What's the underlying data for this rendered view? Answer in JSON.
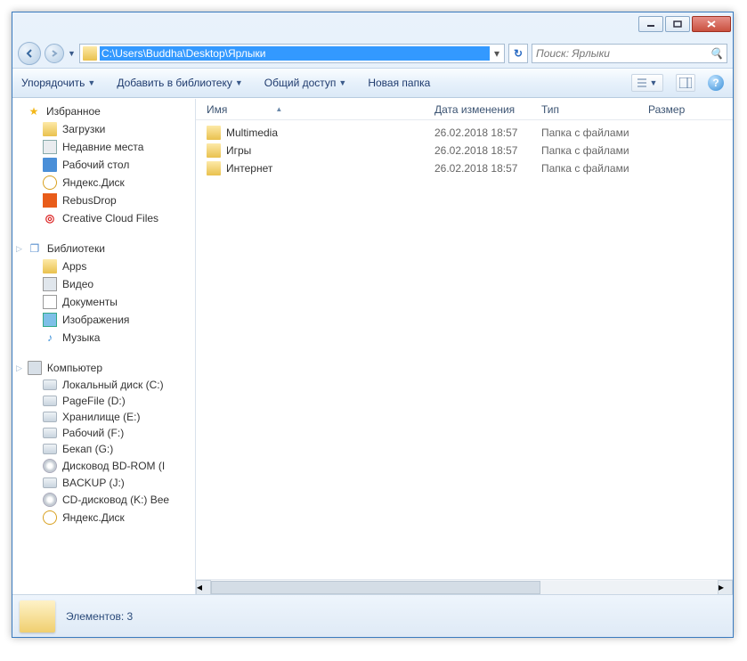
{
  "address": {
    "path": "C:\\Users\\Buddha\\Desktop\\Ярлыки"
  },
  "search": {
    "placeholder": "Поиск: Ярлыки"
  },
  "toolbar": {
    "organize": "Упорядочить",
    "addlib": "Добавить в библиотеку",
    "share": "Общий доступ",
    "newfolder": "Новая папка"
  },
  "tree": {
    "fav_header": "Избранное",
    "fav": [
      {
        "label": "Загрузки",
        "icon": "folder"
      },
      {
        "label": "Недавние места",
        "icon": "recent"
      },
      {
        "label": "Рабочий стол",
        "icon": "desktop"
      },
      {
        "label": "Яндекс.Диск",
        "icon": "yandex"
      },
      {
        "label": "RebusDrop",
        "icon": "rebus"
      },
      {
        "label": "Creative Cloud Files",
        "icon": "cloud"
      }
    ],
    "lib_header": "Библиотеки",
    "lib": [
      {
        "label": "Apps",
        "icon": "folder"
      },
      {
        "label": "Видео",
        "icon": "video"
      },
      {
        "label": "Документы",
        "icon": "doc"
      },
      {
        "label": "Изображения",
        "icon": "img"
      },
      {
        "label": "Музыка",
        "icon": "music"
      }
    ],
    "comp_header": "Компьютер",
    "comp": [
      {
        "label": "Локальный диск (C:)",
        "icon": "drive"
      },
      {
        "label": "PageFile (D:)",
        "icon": "drive"
      },
      {
        "label": "Хранилище (E:)",
        "icon": "drive"
      },
      {
        "label": "Рабочий (F:)",
        "icon": "drive"
      },
      {
        "label": "Бекап (G:)",
        "icon": "drive"
      },
      {
        "label": "Дисковод BD-ROM (I",
        "icon": "disc"
      },
      {
        "label": "BACKUP (J:)",
        "icon": "drive"
      },
      {
        "label": "CD-дисковод (K:) Bee",
        "icon": "disc"
      },
      {
        "label": "Яндекс.Диск",
        "icon": "yandex"
      }
    ]
  },
  "columns": {
    "name": "Имя",
    "date": "Дата изменения",
    "type": "Тип",
    "size": "Размер"
  },
  "files": [
    {
      "name": "Multimedia",
      "date": "26.02.2018 18:57",
      "type": "Папка с файлами"
    },
    {
      "name": "Игры",
      "date": "26.02.2018 18:57",
      "type": "Папка с файлами"
    },
    {
      "name": "Интернет",
      "date": "26.02.2018 18:57",
      "type": "Папка с файлами"
    }
  ],
  "status": {
    "text": "Элементов: 3"
  }
}
